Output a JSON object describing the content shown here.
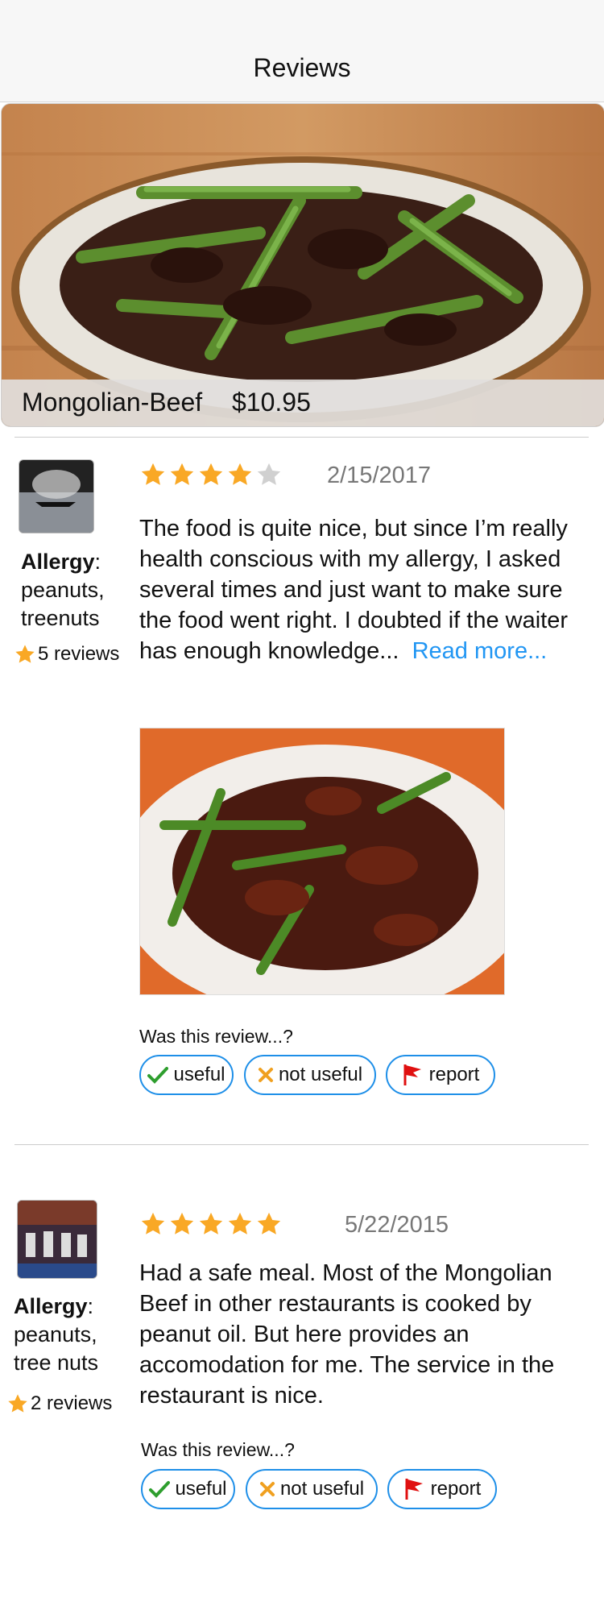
{
  "header": {
    "title": "Reviews"
  },
  "dish": {
    "name": "Mongolian-Beef",
    "price": "$10.95"
  },
  "reviews": [
    {
      "rating": 4,
      "date": "2/15/2017",
      "allergy_label": "Allergy",
      "allergy_items": [
        "peanuts,",
        "treenuts"
      ],
      "review_count": "5 reviews",
      "text": "The food is quite nice, but since I’m really health conscious with my allergy, I asked several times and just want to make sure the food went right. I doubted if the waiter has enough knowledge...",
      "read_more": "Read more...",
      "question": "Was this review...?",
      "useful_label": "useful",
      "not_useful_label": "not useful",
      "report_label": "report"
    },
    {
      "rating": 5,
      "date": "5/22/2015",
      "allergy_label": "Allergy",
      "allergy_items": [
        "peanuts,",
        "tree nuts"
      ],
      "review_count": "2 reviews",
      "text": "Had a safe meal. Most of the Mongolian Beef in other restaurants is cooked by peanut oil. But here provides an accomodation for me. The service in the restaurant is nice.",
      "question": "Was this review...?",
      "useful_label": "useful",
      "not_useful_label": "not useful",
      "report_label": "report"
    }
  ],
  "colors": {
    "star_filled": "#f9a825",
    "star_empty": "#d0d0d0",
    "accent_blue": "#1e8fe8",
    "check_green": "#2e9e2e",
    "x_orange": "#f0a020",
    "flag_red": "#e01010"
  },
  "icons": {
    "star": "star-icon",
    "useful": "checkmark-icon",
    "not_useful": "x-icon",
    "report": "flag-icon"
  }
}
